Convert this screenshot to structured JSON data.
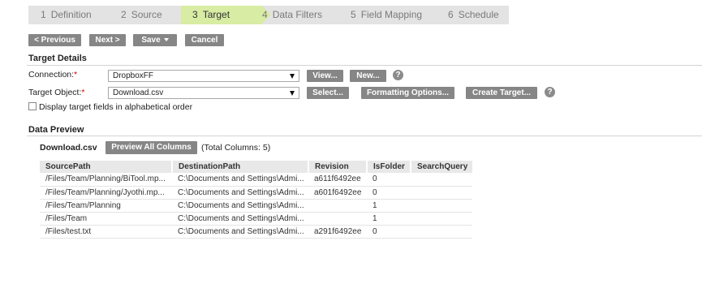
{
  "wizard": {
    "steps": [
      {
        "num": "1",
        "label": "Definition"
      },
      {
        "num": "2",
        "label": "Source"
      },
      {
        "num": "3",
        "label": "Target"
      },
      {
        "num": "4",
        "label": "Data Filters"
      },
      {
        "num": "5",
        "label": "Field Mapping"
      },
      {
        "num": "6",
        "label": "Schedule"
      }
    ],
    "active_step": 3
  },
  "toolbar": {
    "previous": "< Previous",
    "next": "Next >",
    "save": "Save",
    "cancel": "Cancel"
  },
  "target_details": {
    "title": "Target Details",
    "connection_label": "Connection:",
    "connection_value": "DropboxFF",
    "view_button": "View...",
    "new_button": "New...",
    "target_object_label": "Target Object:",
    "target_object_value": "Download.csv",
    "select_button": "Select...",
    "formatting_button": "Formatting Options...",
    "create_target_button": "Create Target...",
    "required_mark": "*",
    "alphabetical_label": "Display target fields in alphabetical order",
    "alphabetical_checked": false,
    "help_glyph": "?"
  },
  "data_preview": {
    "title": "Data Preview",
    "file_name": "Download.csv",
    "preview_all_button": "Preview All Columns",
    "total_columns": "(Total Columns: 5)",
    "columns": [
      "SourcePath",
      "DestinationPath",
      "Revision",
      "IsFolder",
      "SearchQuery"
    ],
    "rows": [
      [
        "/Files/Team/Planning/BiTool.mp...",
        "C:\\Documents and Settings\\Admi...",
        "a611f6492ee",
        "0",
        ""
      ],
      [
        "/Files/Team/Planning/Jyothi.mp...",
        "C:\\Documents and Settings\\Admi...",
        "a601f6492ee",
        "0",
        ""
      ],
      [
        "/Files/Team/Planning",
        "C:\\Documents and Settings\\Admi...",
        "",
        "1",
        ""
      ],
      [
        "/Files/Team",
        "C:\\Documents and Settings\\Admi...",
        "",
        "1",
        ""
      ],
      [
        "/Files/test.txt",
        "C:\\Documents and Settings\\Admi...",
        "a291f6492ee",
        "0",
        ""
      ]
    ]
  },
  "colors": {
    "active_step": "#d9eca4",
    "step_bar": "#e3e3e3",
    "button": "#868686",
    "required": "#d40000"
  }
}
